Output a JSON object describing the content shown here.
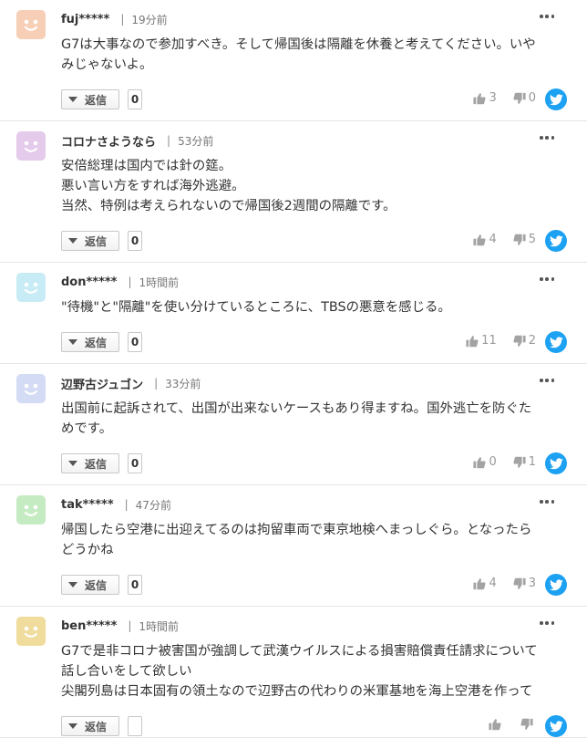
{
  "ui": {
    "reply_label": "返信",
    "more_icon": "more-dots-icon",
    "share_icon": "twitter-icon"
  },
  "colors": {
    "twitter": "#1da1f2",
    "face": "#ffffff"
  },
  "comments": [
    {
      "user": "fuj*****",
      "time": "19分前",
      "avatar_color": "#f7cfb6",
      "lines": [
        "G7は大事なので参加すべき。そして帰国後は隔離を休養と考えてください。いや",
        "みじゃないよ。"
      ],
      "replies": "0",
      "likes": "3",
      "dislikes": "0"
    },
    {
      "user": "コロナさようなら",
      "time": "53分前",
      "avatar_color": "#e4caeb",
      "lines": [
        "安倍総理は国内では針の筵。",
        "悪い言い方をすれば海外逃避。",
        "当然、特例は考えられないので帰国後2週間の隔離です。"
      ],
      "replies": "0",
      "likes": "4",
      "dislikes": "5"
    },
    {
      "user": "don*****",
      "time": "1時間前",
      "avatar_color": "#c8ecf5",
      "lines": [
        "\"待機\"と\"隔離\"を使い分けているところに、TBSの悪意を感じる。"
      ],
      "replies": "0",
      "likes": "11",
      "dislikes": "2"
    },
    {
      "user": "辺野古ジュゴン",
      "time": "33分前",
      "avatar_color": "#d4dbf4",
      "lines": [
        "出国前に起訴されて、出国が出来ないケースもあり得ますね。国外逃亡を防ぐた",
        "めです。"
      ],
      "replies": "0",
      "likes": "0",
      "dislikes": "1"
    },
    {
      "user": "tak*****",
      "time": "47分前",
      "avatar_color": "#c5ebc2",
      "lines": [
        "帰国したら空港に出迎えてるのは拘留車両で東京地検へまっしぐら。となったら",
        "どうかね"
      ],
      "replies": "0",
      "likes": "4",
      "dislikes": "3"
    },
    {
      "user": "ben*****",
      "time": "1時間前",
      "avatar_color": "#f0dc9c",
      "lines": [
        "G7で是非コロナ被害国が強調して武漢ウイルスによる損害賠償責任請求について",
        "話し合いをして欲しい",
        "尖閣列島は日本固有の領土なので辺野古の代わりの米軍基地を海上空港を作って"
      ],
      "replies": "",
      "likes": "",
      "dislikes": ""
    }
  ]
}
